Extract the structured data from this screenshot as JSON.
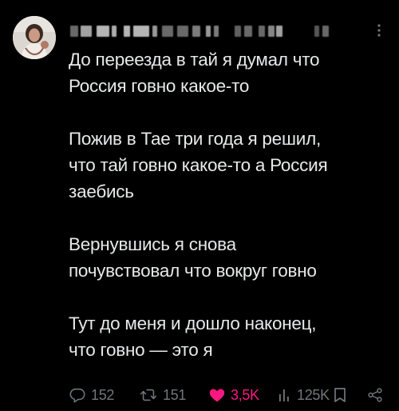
{
  "tweet": {
    "author": {
      "name": "",
      "handle": ""
    },
    "paragraphs": [
      [
        "До переезда в тай я думал что",
        "Россия говно какое-то"
      ],
      [
        "Пожив в Тае три года я решил,",
        "что тай говно какое-то а Россия",
        "заебись"
      ],
      [
        "Вернувшись я снова",
        "почувствовал что вокруг говно"
      ],
      [
        "Тут до меня и дошло наконец,",
        "что говно — это я"
      ]
    ],
    "actions": {
      "replies": "152",
      "reposts": "151",
      "likes": "3,5K",
      "views": "125K"
    }
  },
  "colors": {
    "background": "#000000",
    "text": "#e7e9ea",
    "muted": "#71767b",
    "like": "#f91880"
  },
  "icons": [
    "more-icon",
    "reply-icon",
    "repost-icon",
    "heart-icon",
    "views-icon",
    "bookmark-icon",
    "share-icon"
  ]
}
